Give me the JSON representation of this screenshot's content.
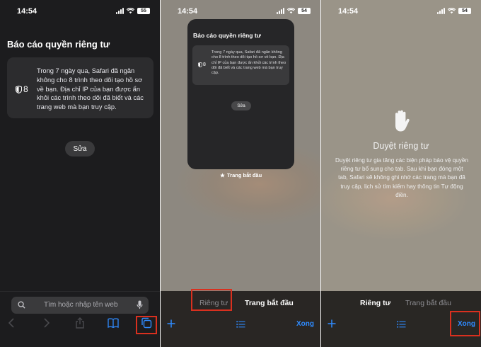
{
  "status_bar": {
    "time": "14:54",
    "battery_panel1": "55",
    "battery_panel2": "54",
    "battery_panel3": "54"
  },
  "panel1": {
    "title": "Báo cáo quyền riêng tư",
    "tracker_count": "8",
    "report_text": "Trong 7 ngày qua, Safari đã ngăn không cho 8 trình theo dõi tạo hồ sơ về bạn. Địa chỉ IP của bạn được ẩn khỏi các trình theo dõi đã biết và các trang web mà bạn truy cập.",
    "edit_label": "Sửa",
    "search_placeholder": "Tìm hoặc nhập tên web"
  },
  "panel2": {
    "card_title": "Báo cáo quyền riêng tư",
    "tracker_count": "8",
    "card_text": "Trong 7 ngày qua, Safari đã ngăn không cho 8 trình theo dõi tạo hồ sơ về bạn. Địa chỉ IP của bạn được ẩn khỏi các trình theo dõi đã biết và các trang web mà bạn truy cập.",
    "edit_label": "Sửa",
    "tab_label": "Trang bắt đầu",
    "segment_private": "Riêng tư",
    "segment_start": "Trang bắt đầu",
    "done_label": "Xong"
  },
  "panel3": {
    "title": "Duyệt riêng tư",
    "description": "Duyệt riêng tư gia tăng các biện pháp bảo vệ quyền riêng tư bổ sung cho tab. Sau khi bạn đóng một tab, Safari sẽ không ghi nhớ các trang mà bạn đã truy cập, lịch sử tìm kiếm hay thông tin Tự động điền.",
    "segment_private": "Riêng tư",
    "segment_start": "Trang bắt đầu",
    "done_label": "Xong"
  },
  "colors": {
    "accent": "#2f8bff",
    "highlight": "#d9301f",
    "dark_bg": "#1c1c1e"
  }
}
